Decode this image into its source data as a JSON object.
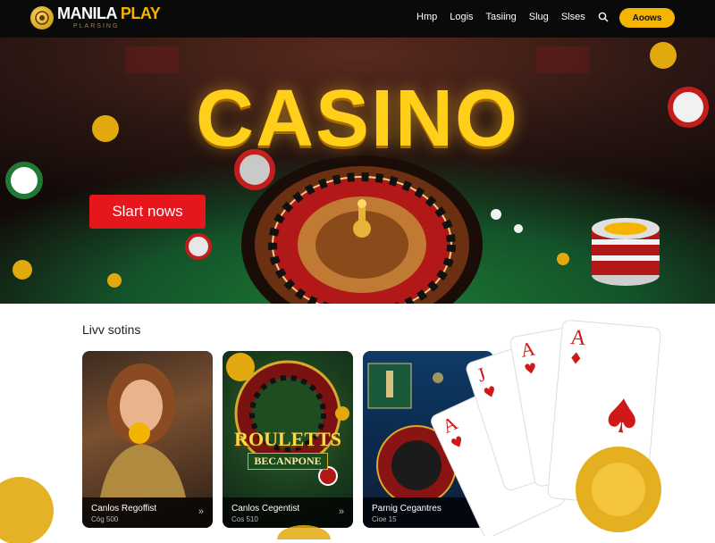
{
  "header": {
    "logo": {
      "word1": "MANILA",
      "word2": "PLAY",
      "subtitle": "PLARSING"
    },
    "nav": [
      {
        "label": "Hmp"
      },
      {
        "label": "Logis"
      },
      {
        "label": "Tasiing"
      },
      {
        "label": "Slug"
      },
      {
        "label": "Slses"
      }
    ],
    "search_icon": "search-icon",
    "cta_label": "Aoows"
  },
  "hero": {
    "title": "CASINO",
    "button_label": "Slart nows"
  },
  "live": {
    "section_title": "Livv sotins",
    "cards": [
      {
        "name": "Canlos Regoffist",
        "meta": "Cög 500"
      },
      {
        "name": "Canlos Cegentist",
        "meta": "Cos 510",
        "art_title": "ROULETTS",
        "art_subtitle": "BECANPONE"
      },
      {
        "name": "Parnig Cegantres",
        "meta": "Cioe 15"
      }
    ]
  },
  "colors": {
    "accent": "#f4b400",
    "cta_red": "#e5161c",
    "header_bg": "#0a0a0a"
  }
}
